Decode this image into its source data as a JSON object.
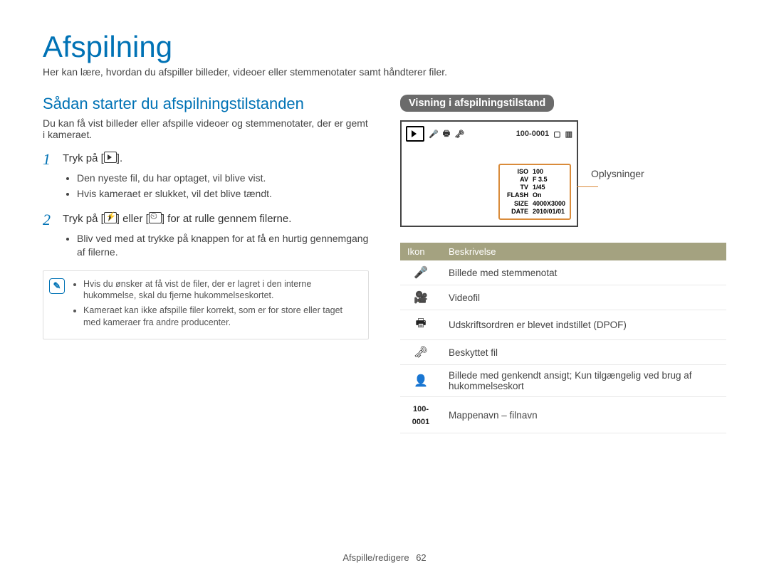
{
  "title": "Afspilning",
  "intro": "Her kan lære, hvordan du afspiller billeder, videoer eller stemmenotater samt håndterer filer.",
  "left": {
    "subhead": "Sådan starter du afspilningstilstanden",
    "lead": "Du kan få vist billeder eller afspille videoer og stemmenotater, der er gemt i kameraet.",
    "step1_num": "1",
    "step1_prefix": "Tryk på [",
    "step1_suffix": "].",
    "step1_bullets": [
      "Den nyeste fil, du har optaget, vil blive vist.",
      "Hvis kameraet er slukket, vil det blive tændt."
    ],
    "step2_num": "2",
    "step2_prefix": "Tryk på [",
    "step2_mid": "] eller [",
    "step2_suffix": "] for at rulle gennem filerne.",
    "step2_bullets": [
      "Bliv ved med at trykke på knappen for at få en hurtig gennemgang af filerne."
    ],
    "note": [
      "Hvis du ønsker at få vist de filer, der er lagret i den interne hukommelse, skal du fjerne hukommelseskortet.",
      "Kameraet kan ikke afspille filer korrekt, som er for store eller taget med kameraer fra andre producenter."
    ]
  },
  "right": {
    "badge": "Visning i afspilningstilstand",
    "file_id": "100-0001",
    "info_label": "Oplysninger",
    "info_rows": [
      {
        "k": "ISO",
        "v": "100"
      },
      {
        "k": "AV",
        "v": "F 3.5"
      },
      {
        "k": "TV",
        "v": "1/45"
      },
      {
        "k": "FLASH",
        "v": "On"
      },
      {
        "k": "SIZE",
        "v": "4000X3000"
      },
      {
        "k": "DATE",
        "v": "2010/01/01"
      }
    ],
    "table_head": {
      "c1": "Ikon",
      "c2": "Beskrivelse"
    },
    "rows": [
      {
        "glyph": "🎤",
        "text": "Billede med stemmenotat"
      },
      {
        "glyph": "🎥",
        "text": "Videofil"
      },
      {
        "glyph": "🖶",
        "text": "Udskriftsordren er blevet indstillet (DPOF)"
      },
      {
        "glyph": "🗝",
        "text": "Beskyttet fil"
      },
      {
        "glyph": "👤",
        "text": "Billede med genkendt ansigt; Kun tilgængelig ved brug af hukommelseskort"
      },
      {
        "glyph": "100-0001",
        "text": "Mappenavn – filnavn",
        "file_id": true
      }
    ]
  },
  "footer": {
    "section": "Afspille/redigere",
    "page": "62"
  }
}
